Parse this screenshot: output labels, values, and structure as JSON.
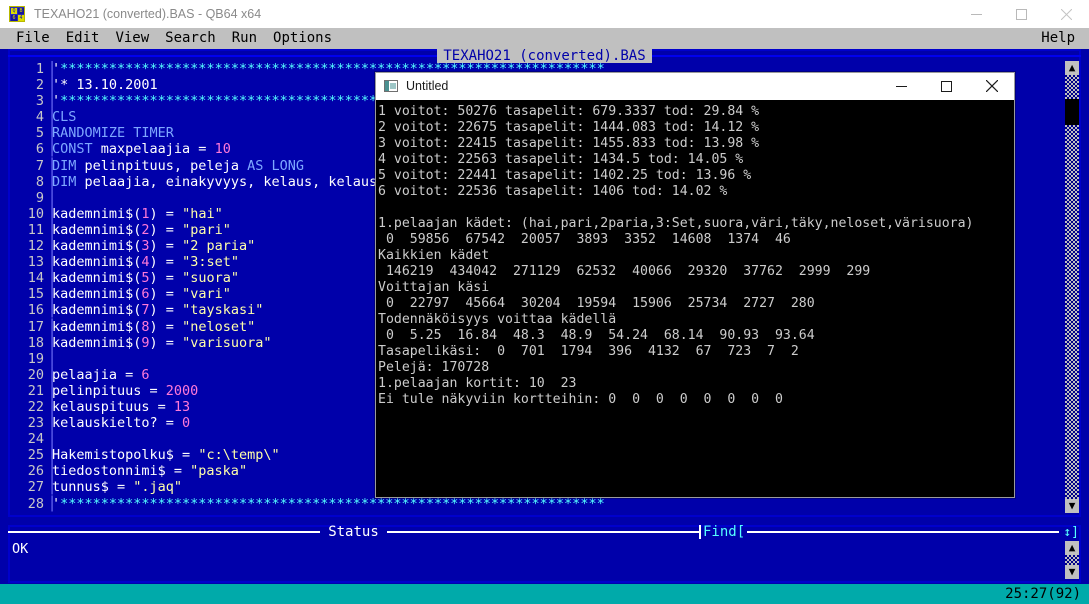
{
  "window": {
    "title": "TEXAHO21 (converted).BAS - QB64 x64",
    "icon": "qb64-icon",
    "controls": {
      "minimize": "minimize-icon",
      "maximize": "maximize-icon",
      "close": "close-icon"
    }
  },
  "menubar": {
    "items": [
      "File",
      "Edit",
      "View",
      "Search",
      "Run",
      "Options"
    ],
    "help": "Help"
  },
  "editor": {
    "title": "TEXAHO21 (converted).BAS",
    "lines": [
      {
        "n": "1",
        "parts": [
          {
            "t": "'",
            "c": "c-white"
          },
          {
            "t": "*******************************************************************",
            "c": "c-cyan"
          }
        ]
      },
      {
        "n": "2",
        "parts": [
          {
            "t": "'",
            "c": "c-white"
          },
          {
            "t": "* 13.10.2001",
            "c": "c-white"
          }
        ]
      },
      {
        "n": "3",
        "parts": [
          {
            "t": "'",
            "c": "c-white"
          },
          {
            "t": "*******************************************************************",
            "c": "c-cyan"
          }
        ]
      },
      {
        "n": "4",
        "parts": [
          {
            "t": "CLS",
            "c": "c-kw"
          }
        ]
      },
      {
        "n": "5",
        "parts": [
          {
            "t": "RANDOMIZE TIMER",
            "c": "c-kw"
          }
        ]
      },
      {
        "n": "6",
        "parts": [
          {
            "t": "CONST",
            "c": "c-kw"
          },
          {
            "t": " maxpelaajia = ",
            "c": "c-id"
          },
          {
            "t": "10",
            "c": "c-num"
          }
        ]
      },
      {
        "n": "7",
        "parts": [
          {
            "t": "DIM",
            "c": "c-kw"
          },
          {
            "t": " pelinpituus, peleja ",
            "c": "c-id"
          },
          {
            "t": "AS LONG",
            "c": "c-kw"
          }
        ]
      },
      {
        "n": "8",
        "parts": [
          {
            "t": "DIM",
            "c": "c-kw"
          },
          {
            "t": " pelaajia, einakyvyys, kelaus, kelausp",
            "c": "c-id"
          }
        ]
      },
      {
        "n": "9",
        "parts": []
      },
      {
        "n": "10",
        "parts": [
          {
            "t": "kademnimi$(",
            "c": "c-id"
          },
          {
            "t": "1",
            "c": "c-num"
          },
          {
            "t": ") = ",
            "c": "c-id"
          },
          {
            "t": "\"hai\"",
            "c": "c-str"
          }
        ]
      },
      {
        "n": "11",
        "parts": [
          {
            "t": "kademnimi$(",
            "c": "c-id"
          },
          {
            "t": "2",
            "c": "c-num"
          },
          {
            "t": ") = ",
            "c": "c-id"
          },
          {
            "t": "\"pari\"",
            "c": "c-str"
          }
        ]
      },
      {
        "n": "12",
        "parts": [
          {
            "t": "kademnimi$(",
            "c": "c-id"
          },
          {
            "t": "3",
            "c": "c-num"
          },
          {
            "t": ") = ",
            "c": "c-id"
          },
          {
            "t": "\"2 paria\"",
            "c": "c-str"
          }
        ]
      },
      {
        "n": "13",
        "parts": [
          {
            "t": "kademnimi$(",
            "c": "c-id"
          },
          {
            "t": "4",
            "c": "c-num"
          },
          {
            "t": ") = ",
            "c": "c-id"
          },
          {
            "t": "\"3:set\"",
            "c": "c-str"
          }
        ]
      },
      {
        "n": "14",
        "parts": [
          {
            "t": "kademnimi$(",
            "c": "c-id"
          },
          {
            "t": "5",
            "c": "c-num"
          },
          {
            "t": ") = ",
            "c": "c-id"
          },
          {
            "t": "\"suora\"",
            "c": "c-str"
          }
        ]
      },
      {
        "n": "15",
        "parts": [
          {
            "t": "kademnimi$(",
            "c": "c-id"
          },
          {
            "t": "6",
            "c": "c-num"
          },
          {
            "t": ") = ",
            "c": "c-id"
          },
          {
            "t": "\"vari\"",
            "c": "c-str"
          }
        ]
      },
      {
        "n": "16",
        "parts": [
          {
            "t": "kademnimi$(",
            "c": "c-id"
          },
          {
            "t": "7",
            "c": "c-num"
          },
          {
            "t": ") = ",
            "c": "c-id"
          },
          {
            "t": "\"tayskasi\"",
            "c": "c-str"
          }
        ]
      },
      {
        "n": "17",
        "parts": [
          {
            "t": "kademnimi$(",
            "c": "c-id"
          },
          {
            "t": "8",
            "c": "c-num"
          },
          {
            "t": ") = ",
            "c": "c-id"
          },
          {
            "t": "\"neloset\"",
            "c": "c-str"
          }
        ]
      },
      {
        "n": "18",
        "parts": [
          {
            "t": "kademnimi$(",
            "c": "c-id"
          },
          {
            "t": "9",
            "c": "c-num"
          },
          {
            "t": ") = ",
            "c": "c-id"
          },
          {
            "t": "\"varisuora\"",
            "c": "c-str"
          }
        ]
      },
      {
        "n": "19",
        "parts": []
      },
      {
        "n": "20",
        "parts": [
          {
            "t": "pelaajia = ",
            "c": "c-id"
          },
          {
            "t": "6",
            "c": "c-num"
          }
        ]
      },
      {
        "n": "21",
        "parts": [
          {
            "t": "pelinpituus = ",
            "c": "c-id"
          },
          {
            "t": "2000",
            "c": "c-num"
          }
        ]
      },
      {
        "n": "22",
        "parts": [
          {
            "t": "kelauspituus = ",
            "c": "c-id"
          },
          {
            "t": "13",
            "c": "c-num"
          }
        ]
      },
      {
        "n": "23",
        "parts": [
          {
            "t": "kelauskielto? = ",
            "c": "c-id"
          },
          {
            "t": "0",
            "c": "c-num"
          }
        ]
      },
      {
        "n": "24",
        "parts": []
      },
      {
        "n": "25",
        "parts": [
          {
            "t": "Hakemistopolku$ = ",
            "c": "c-id"
          },
          {
            "t": "\"c:\\temp\\\"",
            "c": "c-str"
          }
        ]
      },
      {
        "n": "26",
        "parts": [
          {
            "t": "tiedostonnimi$ = ",
            "c": "c-id"
          },
          {
            "t": "\"paska\"",
            "c": "c-str"
          }
        ]
      },
      {
        "n": "27",
        "parts": [
          {
            "t": "tunnus$ = ",
            "c": "c-id"
          },
          {
            "t": "\".jaq\"",
            "c": "c-str"
          }
        ]
      },
      {
        "n": "28",
        "parts": [
          {
            "t": "'",
            "c": "c-white"
          },
          {
            "t": "*******************************************************************",
            "c": "c-cyan"
          }
        ]
      }
    ]
  },
  "status_window": {
    "label": "Status",
    "find_label": "Find[",
    "resize_glyph": "↕]",
    "body": "OK"
  },
  "bottom_bar": {
    "position": "25:27(92)"
  },
  "console": {
    "title": "Untitled",
    "icon": "terminal-icon",
    "controls": {
      "minimize": "minimize-icon",
      "maximize": "maximize-icon",
      "close": "close-icon"
    },
    "output": [
      "1 voitot: 50276 tasapelit: 679.3337 tod: 29.84 %",
      "2 voitot: 22675 tasapelit: 1444.083 tod: 14.12 %",
      "3 voitot: 22415 tasapelit: 1455.833 tod: 13.98 %",
      "4 voitot: 22563 tasapelit: 1434.5 tod: 14.05 %",
      "5 voitot: 22441 tasapelit: 1402.25 tod: 13.96 %",
      "6 voitot: 22536 tasapelit: 1406 tod: 14.02 %",
      "",
      "1.pelaajan kädet: (hai,pari,2paria,3:Set,suora,väri,täky,neloset,värisuora)",
      " 0  59856  67542  20057  3893  3352  14608  1374  46",
      "Kaikkien kädet",
      " 146219  434042  271129  62532  40066  29320  37762  2999  299",
      "Voittajan käsi",
      " 0  22797  45664  30204  19594  15906  25734  2727  280",
      "Todennäköisyys voittaa kädellä",
      " 0  5.25  16.84  48.3  48.9  54.24  68.14  90.93  93.64",
      "Tasapelikäsi:  0  701  1794  396  4132  67  723  7  2",
      "Pelejä: 170728",
      "1.pelaajan kortit: 10  23",
      "Ei tule näkyviin kortteihin: 0  0  0  0  0  0  0  0"
    ]
  }
}
